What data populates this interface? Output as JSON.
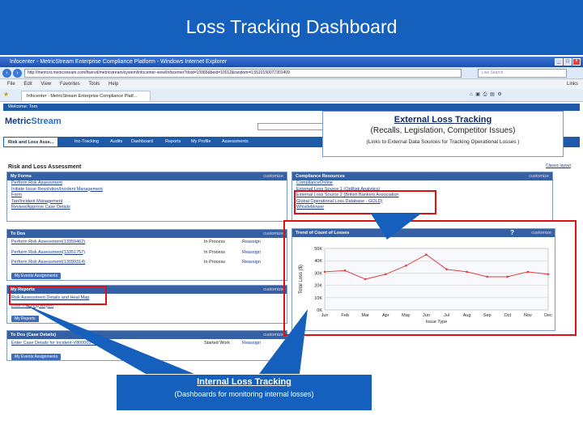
{
  "slide_title": "Loss Tracking Dashboard",
  "browser": {
    "title": "Infocenter - MetricStream Enterprise Compliance Platform - Windows Internet Explorer",
    "address": "http://metricst.metricstream.com/fiservd/metricstream/system/infocenter-view/Infocenter?doid=10065&beid=10012&random=0.5510150077301409",
    "search_placeholder": "Live Search",
    "menu": [
      "File",
      "Edit",
      "View",
      "Favorites",
      "Tools",
      "Help"
    ],
    "tab": "Infocenter - MetricStream Enterprise Compliance Platf...",
    "links_label": "Links"
  },
  "app": {
    "welcome": "Welcome: Tom",
    "logo_a": "Metric",
    "logo_b": "Stream",
    "tabs": [
      "Risk and Loss Asse...",
      "Inc-Tracking",
      "Audits",
      "Dashboard",
      "Reports",
      "My Profile",
      "Assessments"
    ],
    "page_title": "Risk and Loss Assessment",
    "help": "Help",
    "logout": "Logout",
    "classic": "Classic layout"
  },
  "my_forms": {
    "title": "My Forms",
    "customize": "customize",
    "items": [
      "Perform Risk Assessment",
      "Initiate Issue Resolution/Incident Management",
      "Form",
      "Tan/Incident Management",
      "Review/Approve Case Details"
    ]
  },
  "compliance": {
    "title": "Compliance Resources",
    "customize": "customize",
    "items": [
      "ComplianceOnline",
      "External Loss Source 1 (OpRisk Analytics)",
      "External Loss Source 2 (British Bankers Association",
      "Global Operational Loss Database - GOLD)",
      "Whistleblower"
    ]
  },
  "todos": {
    "title": "To Dos",
    "customize": "customize",
    "rows": [
      {
        "name": "Perform Risk Assessment(13359462)",
        "status": "In Process",
        "action": "Reassign"
      },
      {
        "name": "Perform Risk Assessment(13351757)",
        "status": "In Process",
        "action": "Reassign"
      },
      {
        "name": "Perform Risk Assessment(13099314)",
        "status": "In Process",
        "action": "Reassign"
      }
    ],
    "button": "My Events Assignments"
  },
  "reports": {
    "title": "My Reports",
    "customize": "customize",
    "items": [
      "Risk Assessment Details and Heat Map",
      "Loss Tracking Report"
    ],
    "button": "My Reports"
  },
  "case": {
    "title": "To Dos (Case Details)",
    "customize": "customize",
    "row": {
      "name": "Enter Case Details for Incident-V800001-3...",
      "status": "Started Work",
      "action": "Reassign"
    },
    "button": "My Events Assignments"
  },
  "chart_panel": {
    "title": "Trend of Count of Losses",
    "customize": "customize",
    "help": "?"
  },
  "chart_data": {
    "type": "line",
    "title": "",
    "xlabel": "Issue Type",
    "ylabel": "Total Loss ($)",
    "categories": [
      "Jun",
      "Feb",
      "Mar",
      "Apr",
      "May",
      "Jun",
      "Jul",
      "Aug",
      "Sep",
      "Oct",
      "Nov",
      "Dec"
    ],
    "values": [
      31000,
      32000,
      25000,
      29000,
      36000,
      45000,
      33000,
      31000,
      27000,
      27000,
      31000,
      29000
    ],
    "ylim": [
      0,
      50000
    ],
    "yticks": [
      "0K",
      "10K",
      "20K",
      "30K",
      "40K",
      "50K"
    ],
    "grid": true,
    "color": "#e04040"
  },
  "callout_ext": {
    "title": "External Loss Tracking",
    "subtitle": "(Recalls, Legislation, Competitor Issues)",
    "note": "(Links to External Data Sources for Tracking Operational Losses )"
  },
  "callout_int": {
    "title": "Internal Loss Tracking",
    "subtitle": "(Dashboards for monitoring internal losses)"
  },
  "colors": {
    "slide_blue": "#1560bd",
    "header_blue": "#3560a6",
    "highlight_red": "#e01010",
    "series_red": "#e04040"
  }
}
